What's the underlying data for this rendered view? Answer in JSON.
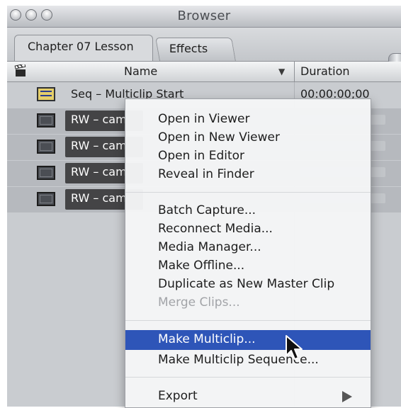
{
  "window": {
    "title": "Browser"
  },
  "tabs": [
    {
      "label": "Chapter 07 Lesson"
    },
    {
      "label": "Effects"
    }
  ],
  "columns": {
    "name": "Name",
    "duration": "Duration"
  },
  "rows": [
    {
      "name": "Seq – Multiclip Start",
      "duration": "00:00:00;00"
    },
    {
      "name": "RW – cam"
    },
    {
      "name": "RW – cam"
    },
    {
      "name": "RW – cam"
    },
    {
      "name": "RW – cam"
    }
  ],
  "context_menu": {
    "group1": [
      "Open in Viewer",
      "Open in New Viewer",
      "Open in Editor",
      "Reveal in Finder"
    ],
    "group2": [
      "Batch Capture...",
      "Reconnect Media...",
      "Media Manager...",
      "Make Offline...",
      "Duplicate as New Master Clip",
      "Merge Clips..."
    ],
    "group3": [
      "Make Multiclip...",
      "Make Multiclip Sequence..."
    ],
    "group4": [
      "Export"
    ],
    "highlight_color": "#2e55b8"
  },
  "icons": {
    "clapper": "clapper-icon",
    "sort": "sort-arrow-icon",
    "sequence": "sequence-icon",
    "clip": "clip-icon",
    "submenu": "submenu-arrow-icon",
    "cursor": "mouse-pointer-icon"
  }
}
